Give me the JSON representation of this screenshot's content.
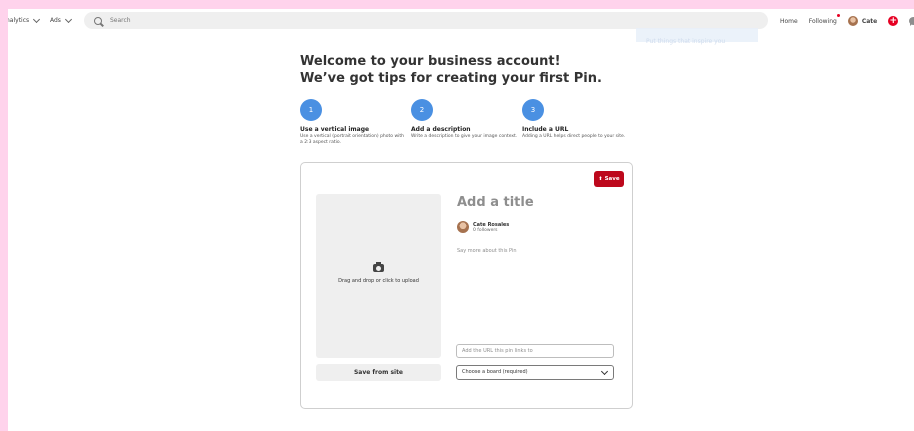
{
  "nav": {
    "analytics": "nalytics",
    "ads": "Ads",
    "search_placeholder": "Search",
    "home": "Home",
    "following": "Following",
    "user": "Cate"
  },
  "faded_tooltip": "Put things that inspire you",
  "header": {
    "line1": "Welcome to your business account!",
    "line2": "We’ve got tips for creating your first Pin."
  },
  "steps": [
    {
      "number": "1",
      "title": "Use a vertical image",
      "desc": "Use a vertical (portrait orientation) photo with a 2:3 aspect ratio."
    },
    {
      "number": "2",
      "title": "Add a description",
      "desc": "Write a description to give your image context."
    },
    {
      "number": "3",
      "title": "Include a URL",
      "desc": "Adding a URL helps direct people to your site."
    }
  ],
  "card": {
    "save": "Save",
    "upload_text": "Drag and drop or click to upload",
    "save_from_site": "Save from site",
    "title_placeholder": "Add a title",
    "author_name": "Cate Rosales",
    "author_followers": "0 followers",
    "description_placeholder": "Say more about this Pin",
    "url_placeholder": "Add the URL this pin links to",
    "board_placeholder": "Choose a board (required)"
  },
  "colors": {
    "brand_red": "#e60023",
    "save_red": "#bd081c",
    "step_blue": "#4a90e2",
    "frame_pink": "#ffd3ec"
  }
}
